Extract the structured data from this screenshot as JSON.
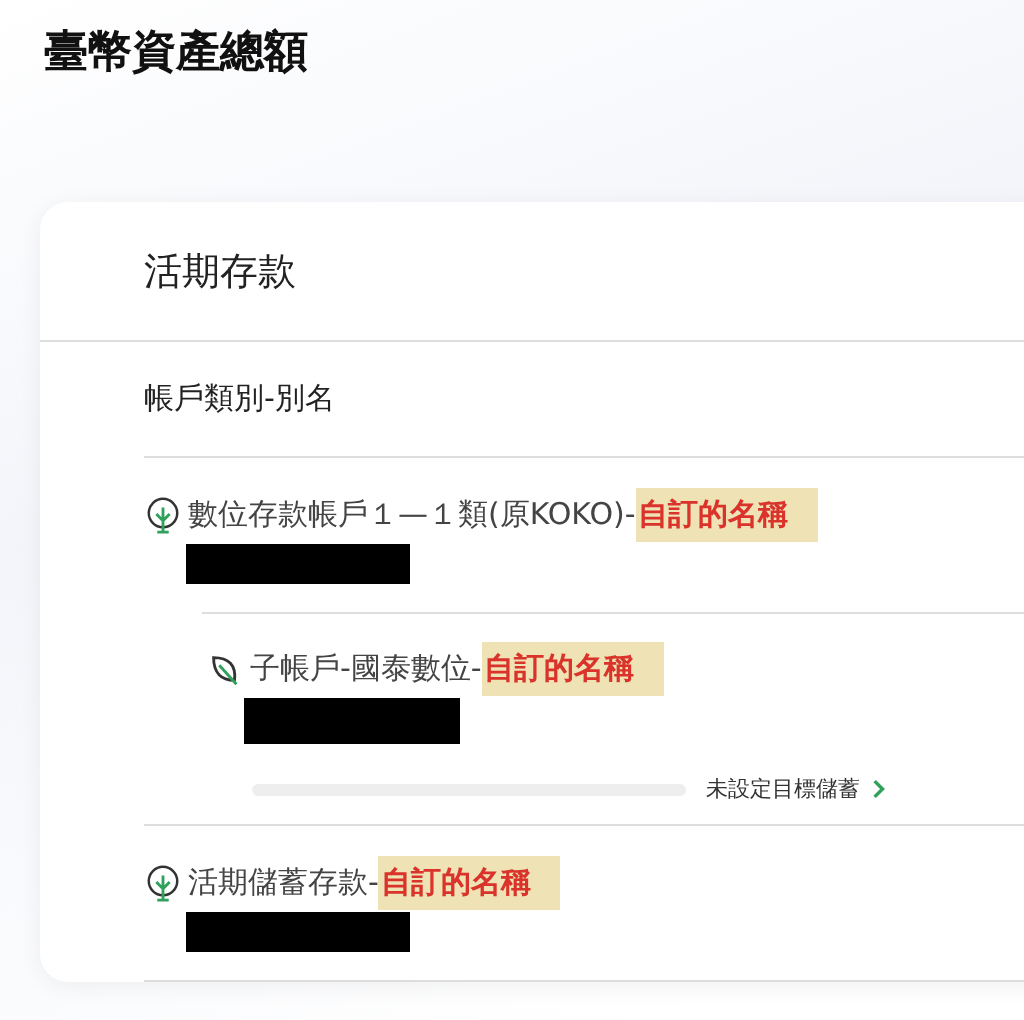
{
  "page_title": "臺幣資產總額",
  "card": {
    "title": "活期存款",
    "column_header": "帳戶類別-別名",
    "accounts": [
      {
        "name": "數位存款帳戶１—１類(原KOKO)-",
        "alias": "自訂的名稱",
        "children": [
          {
            "name": "子帳戶-國泰數位-",
            "alias": "自訂的名稱",
            "goal": {
              "level": 0,
              "label": "未設定目標儲蓄"
            }
          }
        ]
      },
      {
        "name": "活期儲蓄存款-",
        "alias": "自訂的名稱"
      }
    ]
  }
}
